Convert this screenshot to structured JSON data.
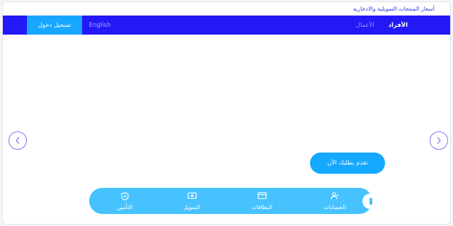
{
  "top_link": {
    "label": "أسعار المنتجات التمويلية والادخارية"
  },
  "nav": {
    "segments": [
      {
        "label": "الأفراد",
        "active": true
      },
      {
        "label": "الأعمال",
        "active": false
      }
    ],
    "language_label": "English",
    "login_label": "تسجيل دخول"
  },
  "hero": {
    "cta_label": "تقدم بطلبك الآن",
    "prev_icon": "chevron-left-icon",
    "next_icon": "chevron-right-icon"
  },
  "quick_links": [
    {
      "label": "الحسابات",
      "icon": "user-group-icon"
    },
    {
      "label": "البطاقات",
      "icon": "card-icon"
    },
    {
      "label": "التمويل",
      "icon": "money-icon"
    },
    {
      "label": "التأمين",
      "icon": "shield-icon"
    }
  ],
  "colors": {
    "nav_bg": "#2318f6",
    "login_bg": "#18a7ff",
    "cta_bg": "#15a8ff",
    "quickbar_bg": "#46c2ff",
    "link_text": "#2b3bd8"
  }
}
